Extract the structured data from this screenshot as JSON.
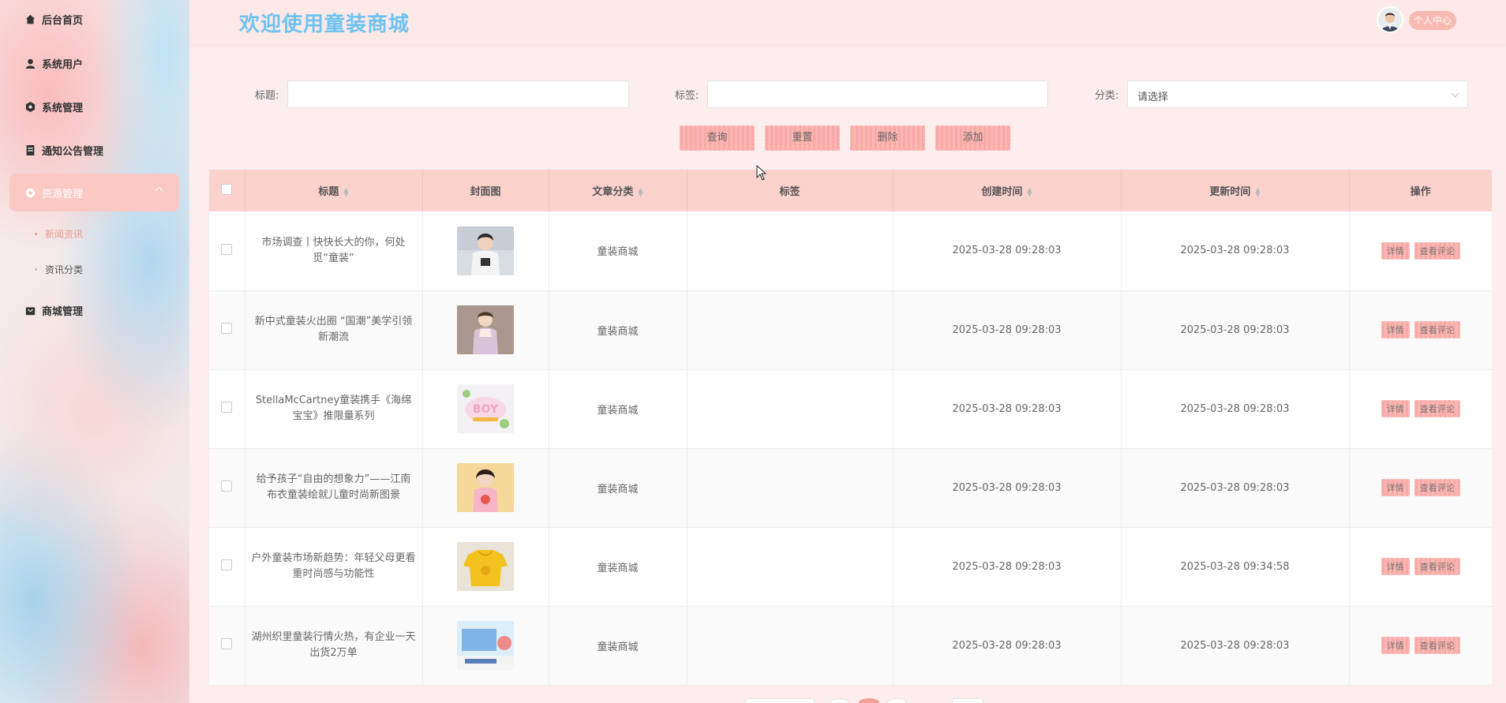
{
  "sidebar": {
    "items": [
      {
        "label": "后台首页",
        "icon": "home-icon"
      },
      {
        "label": "系统用户",
        "icon": "user-icon"
      },
      {
        "label": "系统管理",
        "icon": "gear-icon"
      },
      {
        "label": "通知公告管理",
        "icon": "document-icon"
      },
      {
        "label": "资源管理",
        "icon": "resource-icon"
      },
      {
        "label": "商城管理",
        "icon": "shop-icon"
      }
    ],
    "subitems": [
      {
        "label": "新闻资讯"
      },
      {
        "label": "资讯分类"
      }
    ]
  },
  "header": {
    "title": "欢迎使用童装商城",
    "profile_label": "个人中心"
  },
  "search": {
    "title_label": "标题:",
    "tag_label": "标签:",
    "category_label": "分类:",
    "category_value": "请选择"
  },
  "buttons": {
    "query": "查询",
    "reset": "重置",
    "delete": "删除",
    "add": "添加"
  },
  "table": {
    "headers": {
      "title": "标题",
      "cover": "封面图",
      "category": "文章分类",
      "tag": "标签",
      "created": "创建时间",
      "updated": "更新时间",
      "actions": "操作"
    },
    "detail_label": "详情",
    "comments_label": "查看评论",
    "rows": [
      {
        "title": "市场调查丨快快长大的你，何处觅“童装”",
        "category": "童装商城",
        "tag": "",
        "created": "2025-03-28 09:28:03",
        "updated": "2025-03-28 09:28:03"
      },
      {
        "title": "新中式童装火出圈 “国潮”美学引领新潮流",
        "category": "童装商城",
        "tag": "",
        "created": "2025-03-28 09:28:03",
        "updated": "2025-03-28 09:28:03"
      },
      {
        "title": "StellaMcCartney童装携手《海绵宝宝》推限量系列",
        "category": "童装商城",
        "tag": "",
        "created": "2025-03-28 09:28:03",
        "updated": "2025-03-28 09:28:03"
      },
      {
        "title": "给予孩子“自由的想象力”——江南布衣童装绘就儿童时尚新图景",
        "category": "童装商城",
        "tag": "",
        "created": "2025-03-28 09:28:03",
        "updated": "2025-03-28 09:28:03"
      },
      {
        "title": "户外童装市场新趋势：年轻父母更看重时尚感与功能性",
        "category": "童装商城",
        "tag": "",
        "created": "2025-03-28 09:28:03",
        "updated": "2025-03-28 09:34:58"
      },
      {
        "title": "湖州织里童装行情火热，有企业一天出货2万单",
        "category": "童装商城",
        "tag": "",
        "created": "2025-03-28 09:28:03",
        "updated": "2025-03-28 09:28:03"
      }
    ]
  }
}
